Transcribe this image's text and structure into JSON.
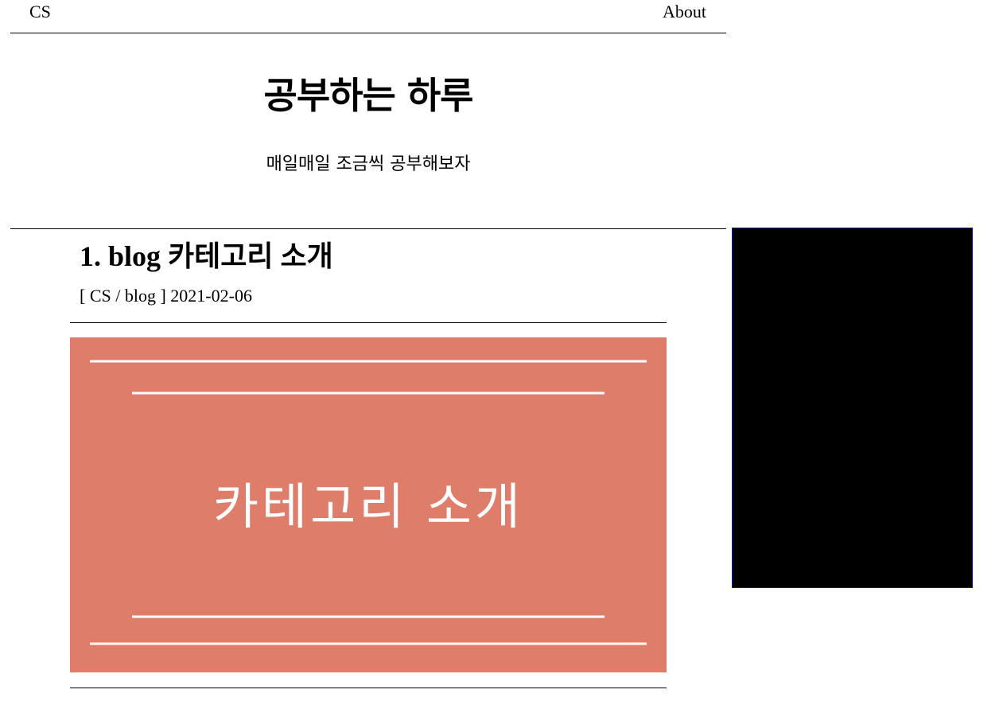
{
  "nav": {
    "left_label": "CS",
    "right_label": "About"
  },
  "header": {
    "title": "공부하는 하루",
    "subtitle": "매일매일 조금씩 공부해보자"
  },
  "post": {
    "title": "1. blog 카테고리 소개",
    "meta": "[ CS / blog ] 2021-02-06",
    "thumbnail": {
      "text": "카테고리 소개",
      "background": "#df7d6b",
      "line_color": "#ffffff"
    }
  },
  "sidebar": {
    "ad_background": "#000000"
  }
}
